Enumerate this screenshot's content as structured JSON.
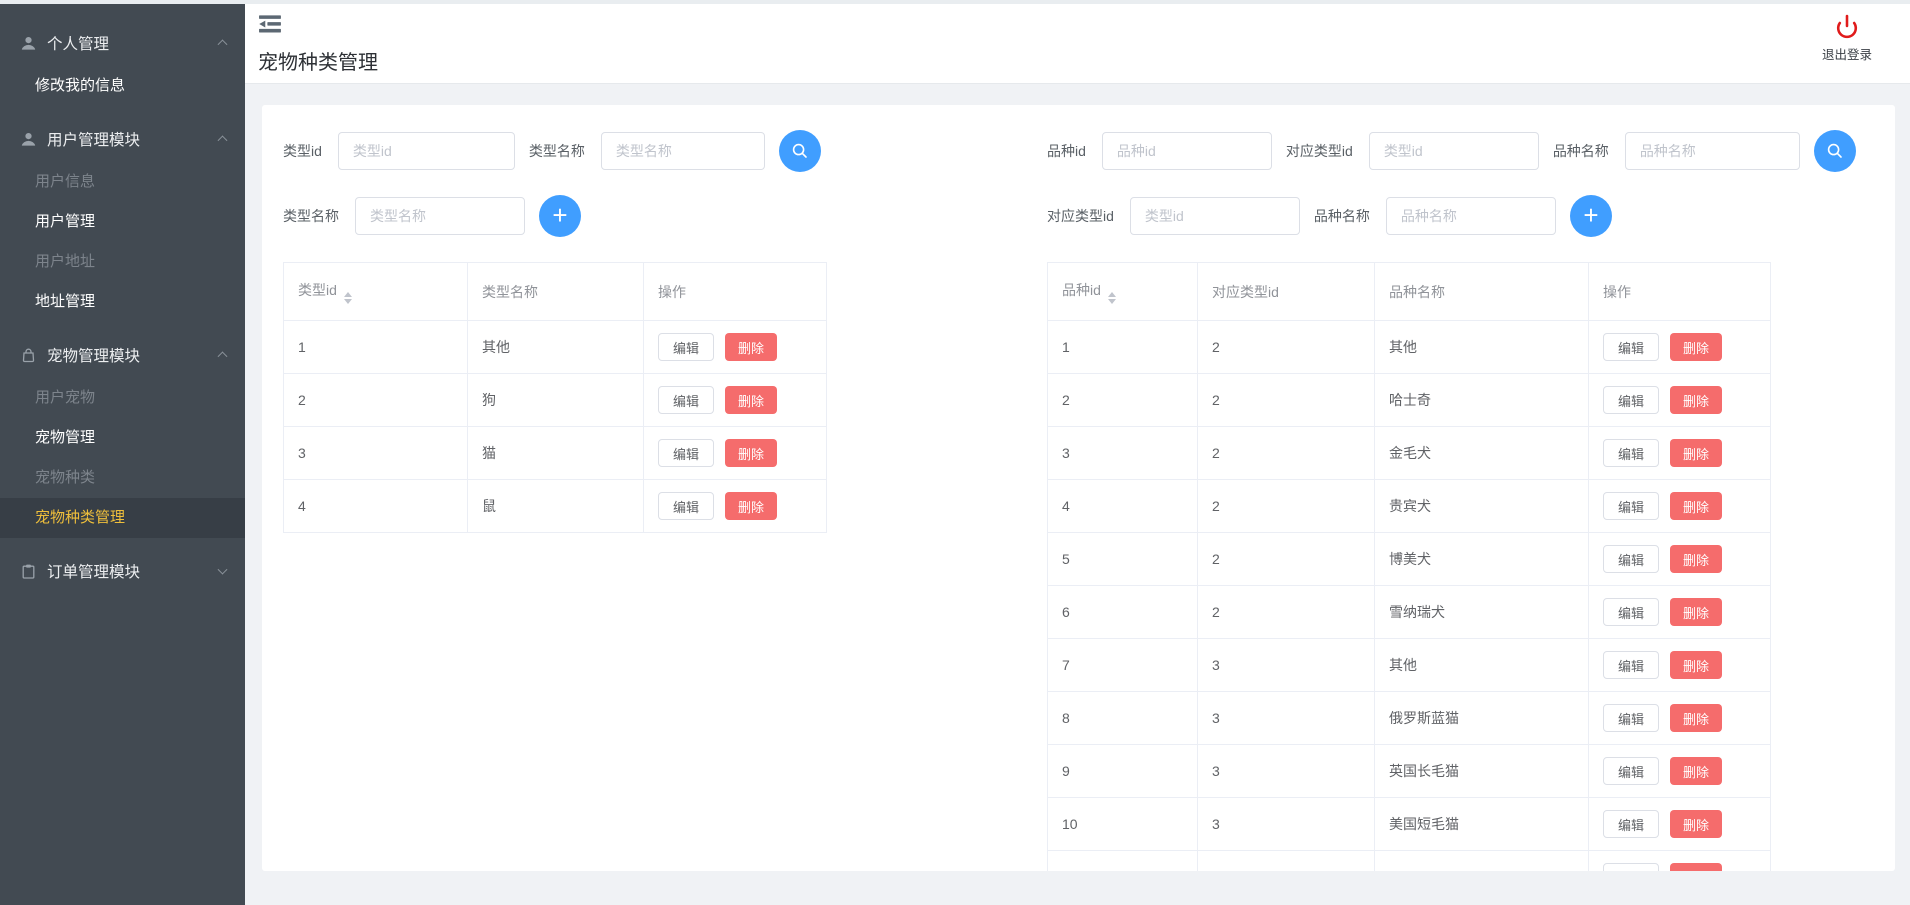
{
  "sidebar": {
    "groups": [
      {
        "label": "个人管理",
        "icon": "user-icon",
        "state": "expanded",
        "items": [
          {
            "label": "修改我的信息",
            "state": "normal"
          }
        ]
      },
      {
        "label": "用户管理模块",
        "icon": "user-icon",
        "state": "expanded",
        "items": [
          {
            "label": "用户信息",
            "state": "dimmed"
          },
          {
            "label": "用户管理",
            "state": "normal"
          },
          {
            "label": "用户地址",
            "state": "dimmed"
          },
          {
            "label": "地址管理",
            "state": "normal"
          }
        ]
      },
      {
        "label": "宠物管理模块",
        "icon": "bag-icon",
        "state": "expanded",
        "items": [
          {
            "label": "用户宠物",
            "state": "dimmed"
          },
          {
            "label": "宠物管理",
            "state": "normal"
          },
          {
            "label": "宠物种类",
            "state": "dimmed"
          },
          {
            "label": "宠物种类管理",
            "state": "active"
          }
        ]
      },
      {
        "label": "订单管理模块",
        "icon": "clipboard-icon",
        "state": "collapsed",
        "items": []
      }
    ]
  },
  "header": {
    "title": "宠物种类管理",
    "logout_label": "退出登录"
  },
  "type_panel": {
    "search": {
      "row1_label1": "类型id",
      "row1_placeholder1": "类型id",
      "row1_label2": "类型名称",
      "row1_placeholder2": "类型名称",
      "row2_label1": "类型名称",
      "row2_placeholder1": "类型名称"
    },
    "table": {
      "columns": [
        "类型id",
        "类型名称",
        "操作"
      ],
      "sortable_column": "类型id",
      "edit_label": "编辑",
      "delete_label": "删除",
      "rows": [
        {
          "id": "1",
          "name": "其他"
        },
        {
          "id": "2",
          "name": "狗"
        },
        {
          "id": "3",
          "name": "猫"
        },
        {
          "id": "4",
          "name": "鼠"
        }
      ]
    }
  },
  "breed_panel": {
    "search": {
      "row1_label1": "品种id",
      "row1_placeholder1": "品种id",
      "row1_label2": "对应类型id",
      "row1_placeholder2": "类型id",
      "row1_label3": "品种名称",
      "row1_placeholder3": "品种名称",
      "row2_label1": "对应类型id",
      "row2_placeholder1": "类型id",
      "row2_label2": "品种名称",
      "row2_placeholder2": "品种名称"
    },
    "table": {
      "columns": [
        "品种id",
        "对应类型id",
        "品种名称",
        "操作"
      ],
      "sortable_column": "品种id",
      "edit_label": "编辑",
      "delete_label": "删除",
      "rows": [
        {
          "id": "1",
          "type_id": "2",
          "name": "其他"
        },
        {
          "id": "2",
          "type_id": "2",
          "name": "哈士奇"
        },
        {
          "id": "3",
          "type_id": "2",
          "name": "金毛犬"
        },
        {
          "id": "4",
          "type_id": "2",
          "name": "贵宾犬"
        },
        {
          "id": "5",
          "type_id": "2",
          "name": "博美犬"
        },
        {
          "id": "6",
          "type_id": "2",
          "name": "雪纳瑞犬"
        },
        {
          "id": "7",
          "type_id": "3",
          "name": "其他"
        },
        {
          "id": "8",
          "type_id": "3",
          "name": "俄罗斯蓝猫"
        },
        {
          "id": "9",
          "type_id": "3",
          "name": "英国长毛猫"
        },
        {
          "id": "10",
          "type_id": "3",
          "name": "美国短毛猫"
        },
        {
          "id": "",
          "type_id": "",
          "name": "",
          "clipped": true
        }
      ]
    }
  },
  "colors": {
    "accent": "#409eff",
    "danger": "#f56c6c",
    "page_bg": "#f0f2f5",
    "sidebar_bg": "#424a52",
    "sidebar_active_bg": "#373e46",
    "sidebar_active_text": "#efbf3b",
    "logout_red": "#e01b1b"
  }
}
